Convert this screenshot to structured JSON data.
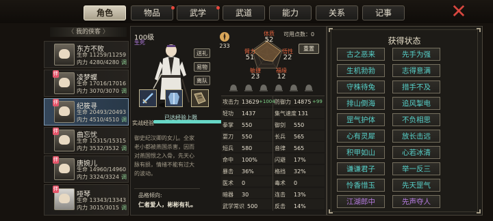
{
  "tabs": [
    {
      "label": "角色",
      "active": true,
      "dot": false
    },
    {
      "label": "物品",
      "active": false,
      "dot": true
    },
    {
      "label": "武学",
      "active": false,
      "dot": true
    },
    {
      "label": "武道",
      "active": false,
      "dot": false
    },
    {
      "label": "能力",
      "active": false,
      "dot": false
    },
    {
      "label": "关系",
      "active": false,
      "dot": false
    },
    {
      "label": "记事",
      "active": false,
      "dot": false
    }
  ],
  "roster": {
    "header": "我的侠客",
    "members": [
      {
        "name": "东方不败",
        "hp": "生命 11259/11259",
        "mp": "内力 4280/4280",
        "tag": "调",
        "badge": "",
        "selected": false
      },
      {
        "name": "凌梦蝶",
        "hp": "生命 17016/17016",
        "mp": "内力 3070/3070",
        "tag": "调",
        "badge": "伴",
        "selected": false
      },
      {
        "name": "纪筱寻",
        "hp": "生命 20493/20493",
        "mp": "内力 4510/4510",
        "tag": "调",
        "badge": "伴",
        "selected": true
      },
      {
        "name": "曲忘忧",
        "hp": "生命 15315/15315",
        "mp": "内力 3532/3532",
        "tag": "调",
        "badge": "伴",
        "selected": false
      },
      {
        "name": "唐婉儿",
        "hp": "生命 14960/14960",
        "mp": "内力 3324/3324",
        "tag": "调",
        "badge": "伴",
        "selected": false
      },
      {
        "name": "哑琴",
        "hp": "生命 13343/13343",
        "mp": "内力 3015/3015",
        "tag": "调",
        "badge": "伴",
        "selected": false
      }
    ]
  },
  "character": {
    "level": "100级",
    "level_tag": "生死",
    "buttons": [
      "送礼",
      "易物",
      "离队"
    ],
    "xp_label": "实战经验",
    "xp_text": "已达经验上限",
    "xp_fraction": 1.0,
    "description": "御史纪汉卿的女儿。全家老小都被燕国杀害，因而对燕国恨之入骨，先天心脉有损，情绪不能有过大的波动。",
    "trait_header": "品格倾向:",
    "trait": "仁者爱人，彬彬有礼。",
    "alignment_value": "233"
  },
  "attributes": {
    "potential_label": "可用点数：0",
    "reset_label": "重置",
    "stats": [
      {
        "label": "体质",
        "value": "52"
      },
      {
        "label": "臂力",
        "value": "51"
      },
      {
        "label": "悟性",
        "value": "22"
      },
      {
        "label": "敏捷",
        "value": "23"
      },
      {
        "label": "福缘",
        "value": "12"
      }
    ]
  },
  "combat_stats": [
    [
      {
        "label": "攻击力",
        "value": "13629",
        "bonus": "+1004"
      },
      {
        "label": "防御力",
        "value": "14875",
        "bonus": "+99"
      }
    ],
    [
      {
        "label": "轻功",
        "value": "1437"
      },
      {
        "label": "集气速度",
        "value": "131"
      }
    ],
    [
      {
        "label": "拳掌",
        "value": "550"
      },
      {
        "label": "御剑",
        "value": "550"
      }
    ],
    [
      {
        "label": "耍刀",
        "value": "550"
      },
      {
        "label": "长兵",
        "value": "565"
      }
    ],
    [
      {
        "label": "短兵",
        "value": "580"
      },
      {
        "label": "音律",
        "value": "565"
      }
    ],
    [
      {
        "label": "命中",
        "value": "100%"
      },
      {
        "label": "闪避",
        "value": "17%"
      }
    ],
    [
      {
        "label": "暴击",
        "value": "36%"
      },
      {
        "label": "格挡",
        "value": "32%"
      }
    ],
    [
      {
        "label": "医术",
        "value": "0"
      },
      {
        "label": "毒术",
        "value": "0"
      }
    ],
    [
      {
        "label": "暗器",
        "value": "30"
      },
      {
        "label": "连击",
        "value": "13%"
      }
    ],
    [
      {
        "label": "武学常识",
        "value": "500"
      },
      {
        "label": "反击",
        "value": "14%"
      }
    ]
  ],
  "status_panel": {
    "title": "获得状态",
    "items": [
      {
        "label": "古之恶来",
        "color": "#57d0c9"
      },
      {
        "label": "先手为强",
        "color": "#57d0c9"
      },
      {
        "label": "生机勃勃",
        "color": "#57d0c9"
      },
      {
        "label": "志得意满",
        "color": "#57d0c9"
      },
      {
        "label": "守株待兔",
        "color": "#57d0c9"
      },
      {
        "label": "措手不及",
        "color": "#57d0c9"
      },
      {
        "label": "排山倒海",
        "color": "#57d0c9"
      },
      {
        "label": "追风掣电",
        "color": "#57d0c9"
      },
      {
        "label": "罡气护体",
        "color": "#57d0c9"
      },
      {
        "label": "不负相思",
        "color": "#57d0c9"
      },
      {
        "label": "心有灵犀",
        "color": "#57d0c9"
      },
      {
        "label": "放长击远",
        "color": "#57d0c9"
      },
      {
        "label": "积甲如山",
        "color": "#57d0c9"
      },
      {
        "label": "心若冰清",
        "color": "#57d0c9"
      },
      {
        "label": "谦谦君子",
        "color": "#57d0c9"
      },
      {
        "label": "举一反三",
        "color": "#57d0c9"
      },
      {
        "label": "怜香惜玉",
        "color": "#57d0c9"
      },
      {
        "label": "先天罡气",
        "color": "#57d0c9"
      },
      {
        "label": "江湖郎中",
        "color": "#b57be0"
      },
      {
        "label": "先声夺人",
        "color": "#b57be0"
      }
    ]
  }
}
